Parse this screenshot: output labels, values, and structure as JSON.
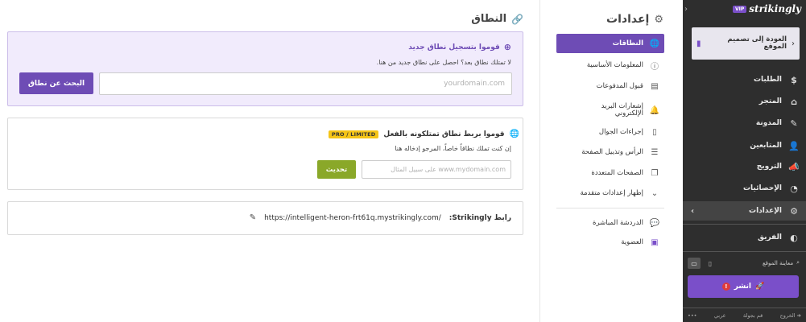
{
  "main": {
    "title": "النطاق",
    "register": {
      "heading": "قوموا بتسجيل نطاق جديد",
      "subtitle": "لا تمتلك نطاق بعد؟ احصل على نطاق جديد من هنا.",
      "placeholder": "yourdomain.com",
      "button": "البحث عن نطاق"
    },
    "connect": {
      "heading": "قوموا بربط نطاق تمتلكونه بالفعل",
      "badge": "PRO / LIMITED",
      "subtitle": "إن كنت تملك نطاقاً خاصاً، المرجو إدخاله هنا",
      "placeholder": "على سبيل المثال www.mydomain.com",
      "button": "تحديث"
    },
    "link": {
      "label": "رابط Strikingly:",
      "url": "https://intelligent-heron-frt61q.mystrikingly.com/"
    }
  },
  "settings_nav": {
    "title": "إعدادات",
    "items": [
      {
        "label": "النطاقات",
        "icon": "globe-icon"
      },
      {
        "label": "المعلومات الأساسية",
        "icon": "info-icon"
      },
      {
        "label": "قبول المدفوعات",
        "icon": "payment-icon"
      },
      {
        "label": "إشعارات البريد الإلكتروني",
        "icon": "bell-icon"
      },
      {
        "label": "إجراءات الجوال",
        "icon": "mobile-icon"
      },
      {
        "label": "الرأس وتذييل الصفحة",
        "icon": "header-footer-icon"
      },
      {
        "label": "الصفحات المتعددة",
        "icon": "pages-icon"
      },
      {
        "label": "إظهار إعدادات متقدمة",
        "icon": "chevron-down-icon"
      },
      {
        "label": "الدردشة المباشرة",
        "icon": "chat-icon"
      },
      {
        "label": "العضوية",
        "icon": "membership-icon"
      }
    ]
  },
  "sidebar": {
    "logo": "strikingly",
    "vip": "VIP",
    "back_label": "العودة إلى تصميم الموقع",
    "items": [
      {
        "label": "الطلبات",
        "icon": "dollar-icon"
      },
      {
        "label": "المتجر",
        "icon": "store-icon"
      },
      {
        "label": "المدونة",
        "icon": "pen-icon"
      },
      {
        "label": "المتابعين",
        "icon": "followers-icon"
      },
      {
        "label": "الترويج",
        "icon": "megaphone-icon"
      },
      {
        "label": "الإحصائيات",
        "icon": "pie-chart-icon"
      },
      {
        "label": "الإعدادات",
        "icon": "gear-icon"
      },
      {
        "label": "الفريق",
        "icon": "team-icon"
      }
    ],
    "preview_label": "معاينة الموقع",
    "publish_label": "انشر",
    "bottom": {
      "logout": "الخروج",
      "tour": "قم بجولة",
      "language": "عربي",
      "more": "•••"
    }
  },
  "colors": {
    "accent": "#6e4cb5",
    "update_button": "#8aa829",
    "pro_badge": "#f5c518",
    "sidebar_bg": "#2e2e2e"
  }
}
